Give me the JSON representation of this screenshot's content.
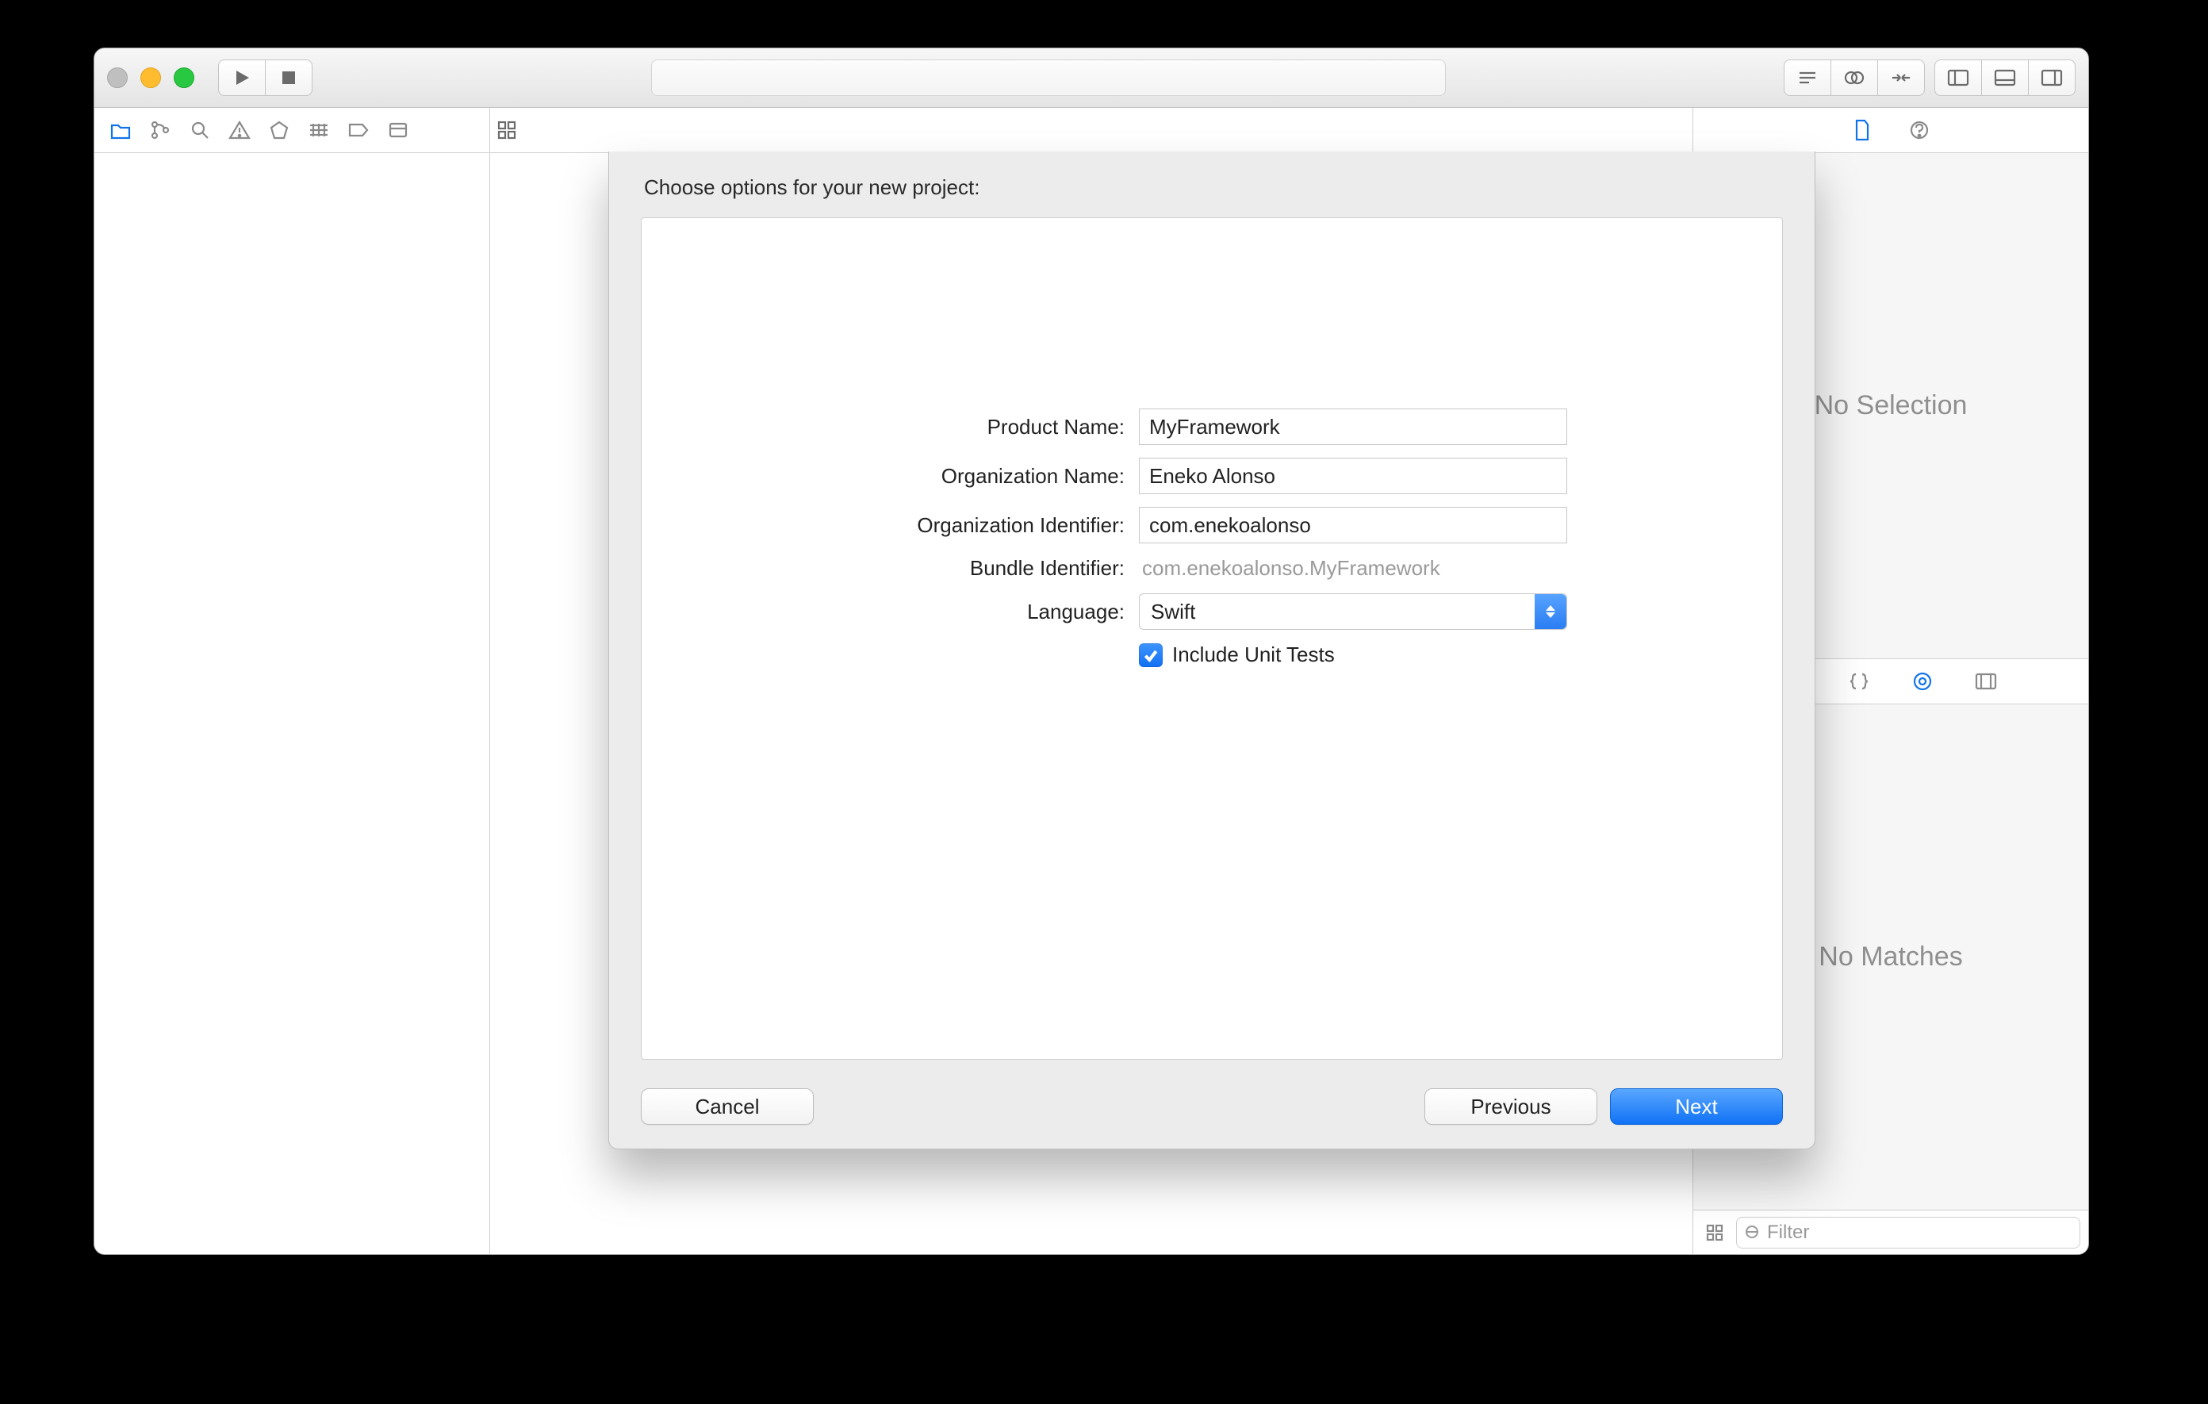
{
  "dialog": {
    "title": "Choose options for your new project:",
    "fields": {
      "product_name_label": "Product Name:",
      "product_name_value": "MyFramework",
      "org_name_label": "Organization Name:",
      "org_name_value": "Eneko Alonso",
      "org_id_label": "Organization Identifier:",
      "org_id_value": "com.enekoalonso",
      "bundle_id_label": "Bundle Identifier:",
      "bundle_id_value": "com.enekoalonso.MyFramework",
      "language_label": "Language:",
      "language_value": "Swift",
      "include_tests_label": "Include Unit Tests",
      "include_tests_checked": true
    },
    "buttons": {
      "cancel": "Cancel",
      "previous": "Previous",
      "next": "Next"
    }
  },
  "inspector": {
    "no_selection": "No Selection",
    "no_matches": "No Matches",
    "filter_placeholder": "Filter"
  }
}
